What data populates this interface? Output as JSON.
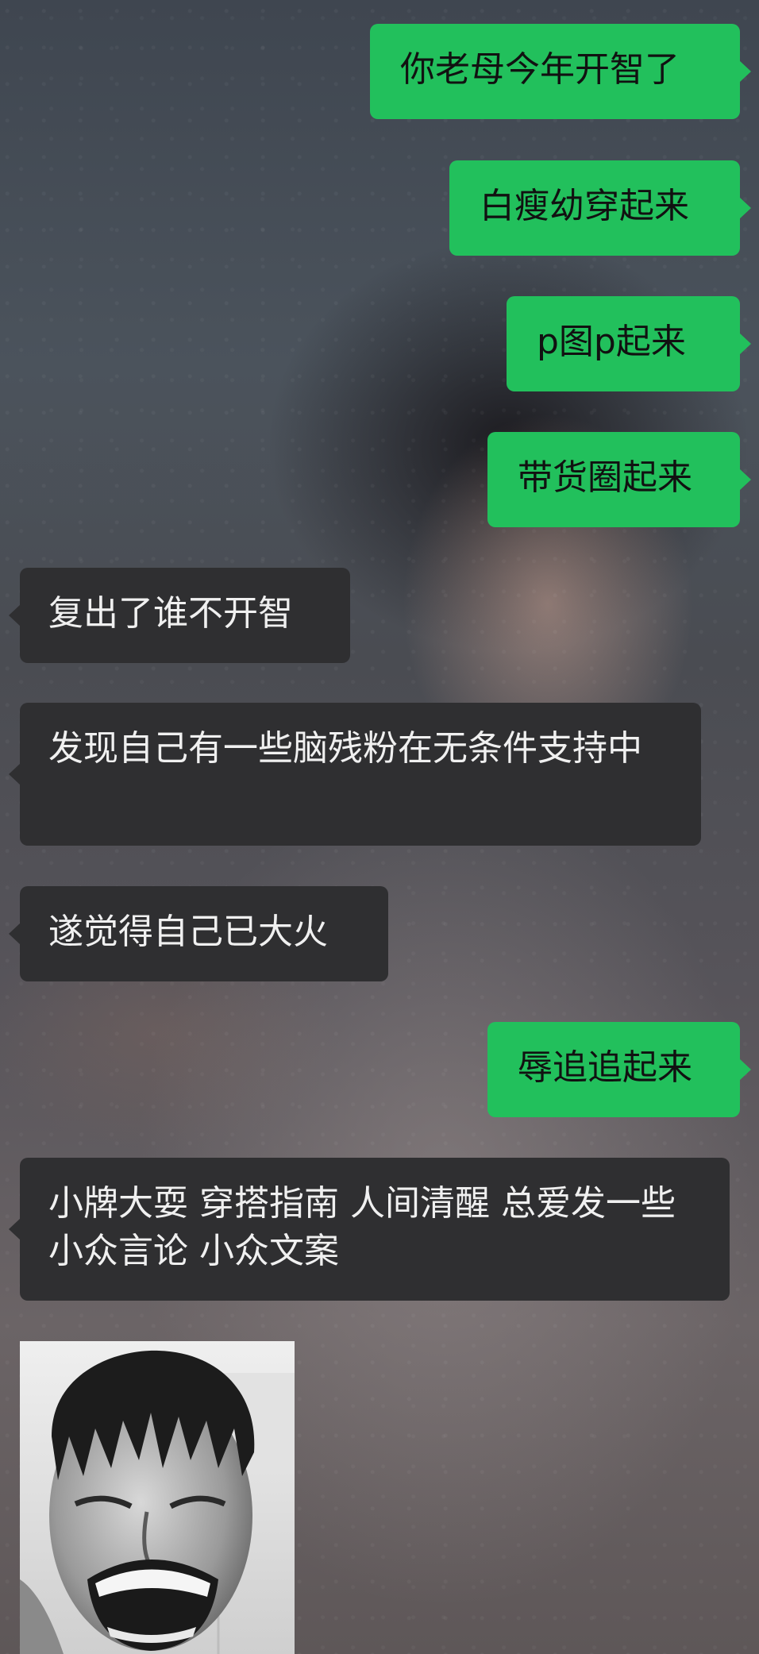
{
  "chat": {
    "messages": [
      {
        "side": "out",
        "text": "你老母今年开智了"
      },
      {
        "side": "out",
        "text": "白瘦幼穿起来"
      },
      {
        "side": "out",
        "text": "p图p起来"
      },
      {
        "side": "out",
        "text": "带货圈起来"
      },
      {
        "side": "in",
        "text": "复出了谁不开智"
      },
      {
        "side": "in",
        "text": "发现自己有一些脑残粉在无条件支持中"
      },
      {
        "side": "in",
        "text": "遂觉得自己已大火"
      },
      {
        "side": "out",
        "text": "辱追追起来"
      },
      {
        "side": "in",
        "text": "小牌大耍 穿搭指南 人间清醒 总爱发一些小众言论 小众文案"
      }
    ],
    "colors": {
      "outgoing_bubble": "#22c05c",
      "incoming_bubble": "#2f2f31",
      "incoming_text": "#f0f0f0"
    },
    "photo": {
      "icon": "laughing-man-photo",
      "style": "black-and-white"
    }
  }
}
